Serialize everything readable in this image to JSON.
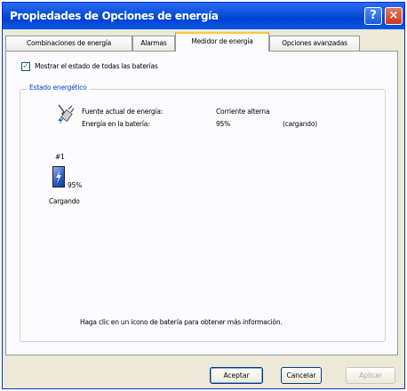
{
  "window": {
    "title": "Propiedades de Opciones de energía",
    "help_glyph": "?",
    "close_glyph": "×"
  },
  "tabs": [
    {
      "label": "Combinaciones de energía",
      "active": false
    },
    {
      "label": "Alarmas",
      "active": false
    },
    {
      "label": "Medidor de energía",
      "active": true
    },
    {
      "label": "Opciones avanzadas",
      "active": false
    }
  ],
  "show_all": {
    "label": "Mostrar el estado de todas las baterías",
    "checked": true
  },
  "status": {
    "group_label": "Estado energético",
    "source_label": "Fuente actual de energía:",
    "source_value": "Corriente alterna",
    "battery_label": "Energía en la batería:",
    "battery_value": "95%",
    "battery_state": "(cargando)"
  },
  "battery": {
    "index": "#1",
    "percent": "95%",
    "status": "Cargando",
    "icon": "battery-charging-icon"
  },
  "hint": "Haga clic en un icono de batería para obtener más información.",
  "buttons": {
    "ok": "Aceptar",
    "cancel": "Cancelar",
    "apply": "Aplicar"
  },
  "colors": {
    "titlebar": "#0a4fd9",
    "active_tab_accent": "#ffc83c",
    "group_label": "#0046d5",
    "checkmark": "#21a121"
  }
}
